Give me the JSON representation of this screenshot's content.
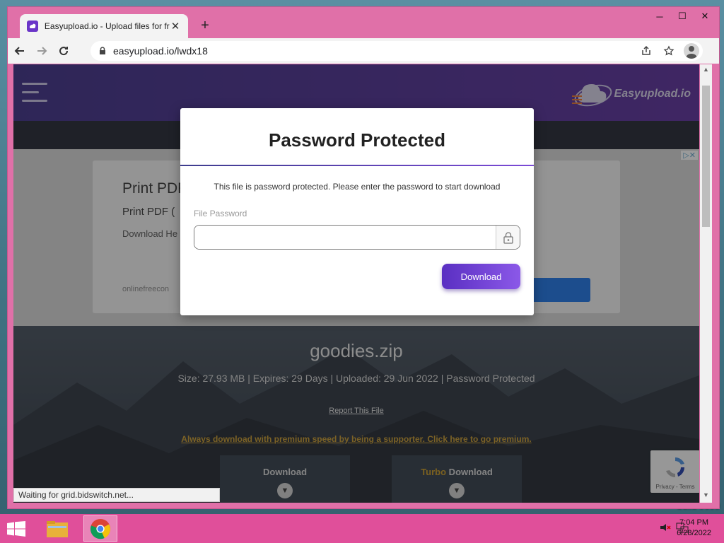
{
  "desktop": {
    "build_text": "build 9600"
  },
  "browser": {
    "tab_title": "Easyupload.io - Upload files for free",
    "tab_close": "✕",
    "new_tab": "+",
    "window_controls": {
      "minimize": "─",
      "maximize": "☐",
      "close": "✕"
    },
    "url": "easyupload.io/lwdx18",
    "menu": "⋮"
  },
  "site": {
    "brand": "Easyupload.io",
    "ad": {
      "title": "Print PDF",
      "subtitle": "Print PDF (",
      "body": "Download He",
      "source": "onlinefreecon",
      "choice": "▷✕"
    },
    "file": {
      "name": "goodies.zip",
      "meta": "Size: 27.93 MB | Expires: 29 Days | Uploaded: 29 Jun 2022 | Password Protected",
      "report": "Report This File",
      "premium": "Always download with premium speed by being a supporter. Click here to go premium."
    },
    "download_cards": [
      {
        "label": "Download",
        "turbo": ""
      },
      {
        "label": " Download",
        "turbo": "Turbo"
      }
    ],
    "recaptcha_footer": "Privacy - Terms"
  },
  "status_bar": "Waiting for grid.bidswitch.net...",
  "modal": {
    "title": "Password Protected",
    "description": "This file is password protected. Please enter the password to start download",
    "password_label": "File Password",
    "password_value": "",
    "button": "Download"
  },
  "taskbar": {
    "time": "7:04 PM",
    "date": "6/28/2022"
  },
  "colors": {
    "accent": "#6a35c8",
    "window_frame": "#e070a8",
    "taskbar": "#e04f9a",
    "premium_link": "#c99a2c"
  }
}
